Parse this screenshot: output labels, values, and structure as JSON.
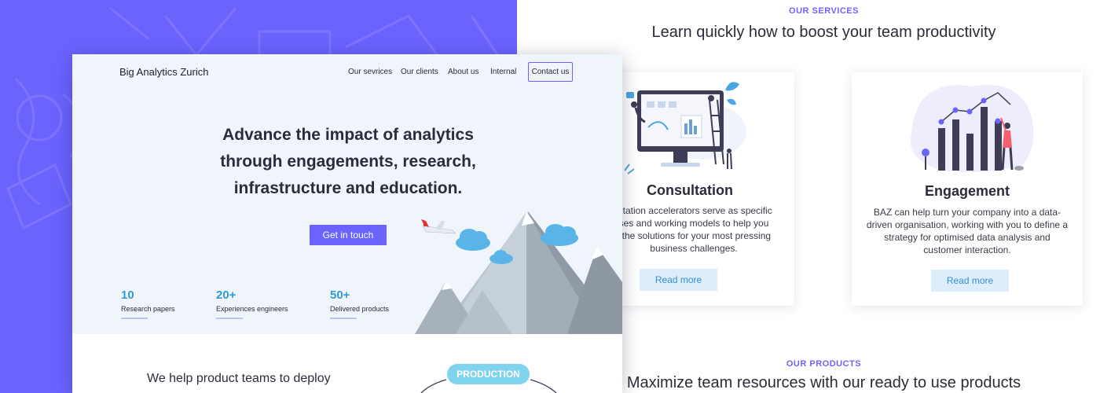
{
  "services": {
    "label": "OUR SERVICES",
    "title": "Learn quickly how to boost your team productivity",
    "cards": [
      {
        "title": "Consultation",
        "text": "ultation accelerators serve as specific ses and working models to help you t the solutions for your most pressing business challenges.",
        "text_lines": [
          "ultation accelerators serve as specific",
          "ses and working models to help you",
          "t the solutions for your most pressing",
          "business challenges."
        ],
        "button": "Read more"
      },
      {
        "title": "Engagement",
        "text": "BAZ can help turn your company into a data-driven organisation, working with you to define a strategy for optimised data analysis and customer interaction.",
        "text_lines": [
          "BAZ can help turn your company into a data-",
          "driven organisation, working with you to define a",
          "strategy for optimised data analysis and",
          "customer interaction."
        ],
        "button": "Read more"
      }
    ]
  },
  "products": {
    "label": "OUR PRODUCTS",
    "title": "Maximize team resources with our ready to use products"
  },
  "site": {
    "brand": "Big Analytics Zurich",
    "nav": [
      "Our sevrices",
      "Our clients",
      "About us",
      "Internal"
    ],
    "contact": "Contact us",
    "headline_lines": [
      "Advance the impact of analytics",
      "through engagements, research,",
      "infrastructure and education."
    ],
    "cta": "Get in touch",
    "stats": [
      {
        "value": "10",
        "label": "Research papers"
      },
      {
        "value": "20+",
        "label": "Experiences engineers"
      },
      {
        "value": "50+",
        "label": "Delivered products"
      }
    ],
    "lower_text": "We help product teams to deploy",
    "production": "PRODUCTION"
  },
  "colors": {
    "accent": "#6c63ff",
    "stat_blue": "#2f9ad8",
    "button_light": "#deedfb",
    "hero_bg": "#f0f5fc"
  },
  "icons": [
    "airplane-icon",
    "cloud-icon",
    "mountain-illustration",
    "monitor-illustration",
    "bar-chart-illustration"
  ]
}
